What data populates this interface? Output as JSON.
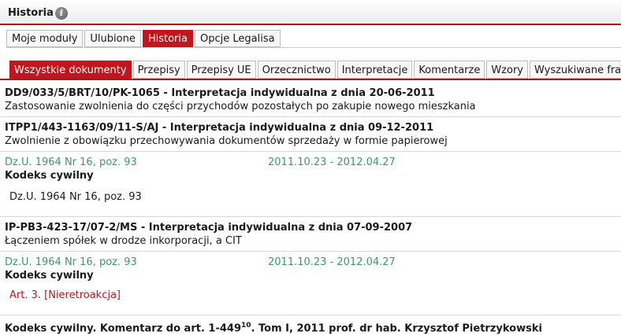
{
  "header": {
    "title": "Historia",
    "info_icon": "info-icon"
  },
  "tabs_main": [
    {
      "label": "Moje moduły",
      "active": false
    },
    {
      "label": "Ulubione",
      "active": false
    },
    {
      "label": "Historia",
      "active": true
    },
    {
      "label": "Opcje Legalisa",
      "active": false
    }
  ],
  "tabs_docs": [
    {
      "label": "Wszystkie dokumenty",
      "active": true
    },
    {
      "label": "Przepisy",
      "active": false
    },
    {
      "label": "Przepisy UE",
      "active": false
    },
    {
      "label": "Orzecznictwo",
      "active": false
    },
    {
      "label": "Interpretacje",
      "active": false
    },
    {
      "label": "Komentarze",
      "active": false
    },
    {
      "label": "Wzory",
      "active": false
    },
    {
      "label": "Wyszukiwane frazy",
      "active": false
    }
  ],
  "items": [
    {
      "head": "DD9/033/5/BRT/10/PK-1065 - Interpretacja indywidualna z dnia 20-06-2011",
      "sub": "Zastosowanie zwolnienia do części przychodów pozostałych po zakupie nowego mieszkania"
    },
    {
      "head": "ITPP1/443-1163/09/11-S/AJ - Interpretacja indywidualna z dnia 09-12-2011",
      "sub": "Zwolnienie z obowiązku przechowywania dokumentów sprzedaży w formie papierowej",
      "rel_source": "Dz.U. 1964 Nr 16, poz. 93",
      "rel_dates": "2011.10.23 - 2012.04.27",
      "rel_act": "Kodeks cywilny",
      "rel_ref": "Dz.U. 1964 Nr 16, poz. 93"
    },
    {
      "head": "IP-PB3-423-17/07-2/MS - Interpretacja indywidualna z dnia 07-09-2007",
      "sub": "Łączeniem spółek w drodze inkorporacji, a CIT",
      "rel_source": "Dz.U. 1964 Nr 16, poz. 93",
      "rel_dates": "2011.10.23 - 2012.04.27",
      "rel_act": "Kodeks cywilny",
      "rel_link": "Art. 3. [Nieretroakcja]"
    },
    {
      "head_pre": "Kodeks cywilny. Komentarz do art. 1-449",
      "head_sup": "10",
      "head_post": ". Tom I, 2011 prof. dr hab. Krzysztof Pietrzykowski"
    }
  ],
  "colors": {
    "accent": "#c0161e",
    "green": "#3a9a6a"
  }
}
